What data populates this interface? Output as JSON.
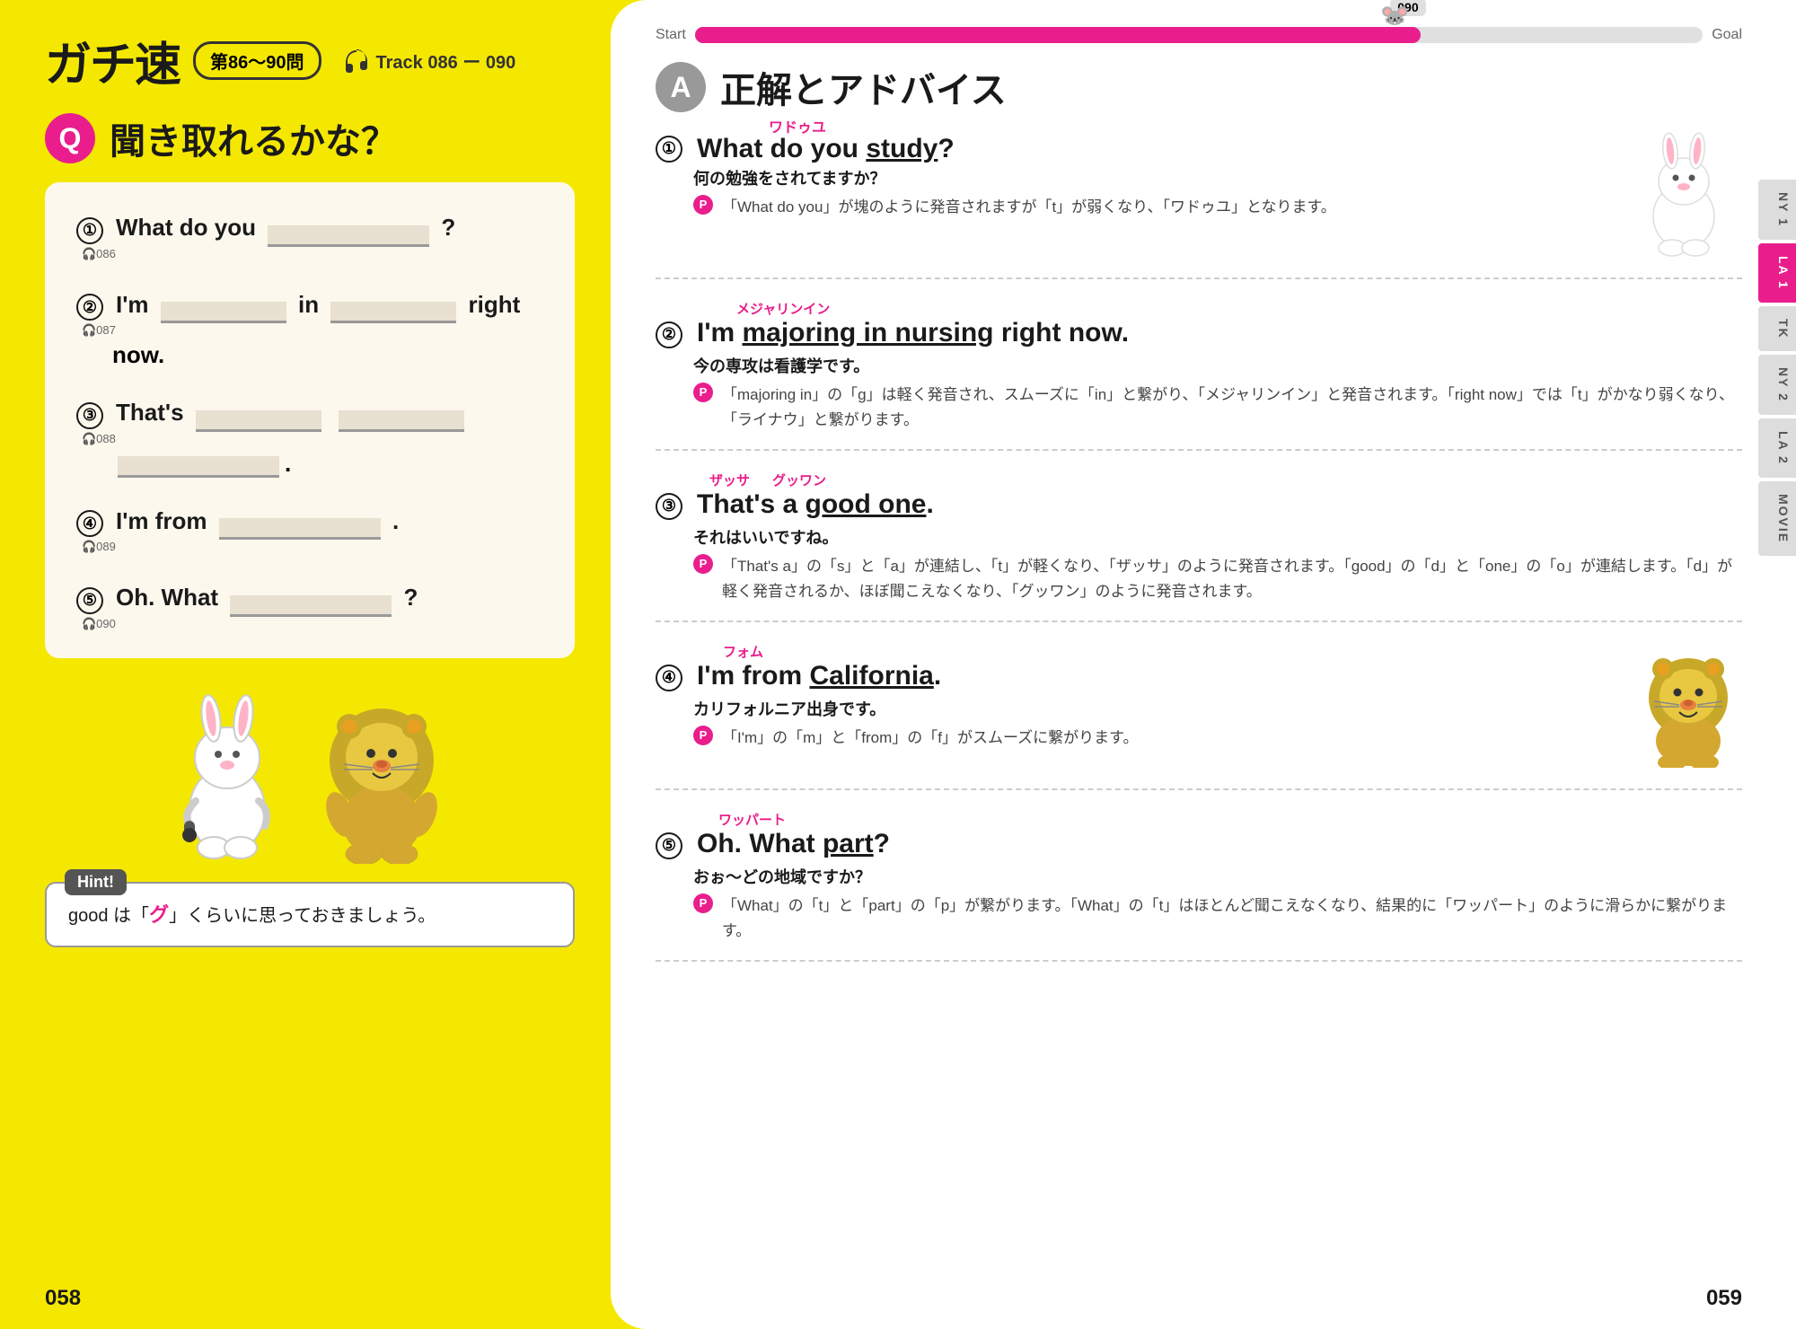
{
  "left": {
    "logo": "ガチ速",
    "question_range": "第86～90問",
    "track_info": "Track 086 ー 090",
    "section_q_label": "Q",
    "section_q_title": "聞き取れるかな？",
    "questions": [
      {
        "num": "①",
        "track": "086",
        "text_before": "What do you",
        "blank1": "",
        "text_after": "?",
        "type": "simple"
      },
      {
        "num": "②",
        "track": "087",
        "text": "I'm",
        "blank1": "",
        "text2": "in",
        "blank2": "",
        "text3": "right now.",
        "type": "double"
      },
      {
        "num": "③",
        "track": "088",
        "text": "That's",
        "blank1": "",
        "blank2": "",
        "blank3": "",
        "text_end": ".",
        "type": "triple"
      },
      {
        "num": "④",
        "track": "089",
        "text": "I'm from",
        "blank1": "",
        "text_end": ".",
        "type": "simple_end"
      },
      {
        "num": "⑤",
        "track": "090",
        "text": "Oh. What",
        "blank1": "",
        "text_end": "?",
        "type": "simple_end"
      }
    ],
    "hint_label": "Hint!",
    "hint_text": "good は「グ」くらいに思っておきましょう。",
    "hint_highlight": "グ",
    "page_num": "058"
  },
  "right": {
    "progress": {
      "start_label": "Start",
      "goal_label": "Goal",
      "current_num": "090",
      "fill_percent": 72
    },
    "section_a_label": "A",
    "section_a_title": "正解とアドバイス",
    "answers": [
      {
        "num": "①",
        "phonetic": "ワドゥユ",
        "title": "What do you study?",
        "underline_words": "study",
        "jp": "何の勉強をされてますか？",
        "advice": "「What do you」が塊のように発音されますが「t」が弱くなり、「ワドゥユ」となります。",
        "has_image": true,
        "image_type": "rabbit"
      },
      {
        "num": "②",
        "phonetic": "メジャリンイン",
        "title": "I'm majoring in nursing right now.",
        "underline_words": "majoring in nursing",
        "jp": "今の専攻は看護学です。",
        "advice": "「majoring in」の「g」は軽く発音され、スムーズに「in」と繋がり、「メジャリンイン」と発音されます。「right now」では「t」がかなり弱くなり、「ライナウ」と繋がります。",
        "has_image": false
      },
      {
        "num": "③",
        "phonetic_a": "ザッサ",
        "phonetic_b": "グッワン",
        "title": "That's a good one.",
        "underline_words": "good one",
        "jp": "それはいいですね。",
        "advice": "「That's a」の「s」と「a」が連結し、「t」が軽くなり、「ザッサ」のように発音されます。「good」の「d」と「one」の「o」が連結します。「d」が軽く発音されるか、ほぼ聞こえなくなり、「グッワン」のように発音されます。",
        "has_image": false
      },
      {
        "num": "④",
        "phonetic": "フォム",
        "title": "I'm from California.",
        "underline_words": "California",
        "jp": "カリフォルニア出身です。",
        "advice": "「I'm」の「m」と「from」の「f」がスムーズに繋がります。",
        "has_image": true,
        "image_type": "lion"
      },
      {
        "num": "⑤",
        "phonetic": "ワッパート",
        "title": "Oh. What part?",
        "underline_words": "part",
        "jp": "おぉ〜どの地域ですか？",
        "advice": "「What」の「t」と「part」の「p」が繋がります。「What」の「t」はほとんど聞こえなくなり、結果的に「ワッパート」のように滑らかに繋がります。",
        "has_image": false
      }
    ],
    "side_tabs": [
      "NY 1",
      "LA 1",
      "TK",
      "NY 2",
      "LA 2",
      "MOVIE"
    ],
    "active_tab": "LA 1",
    "page_num": "059"
  }
}
